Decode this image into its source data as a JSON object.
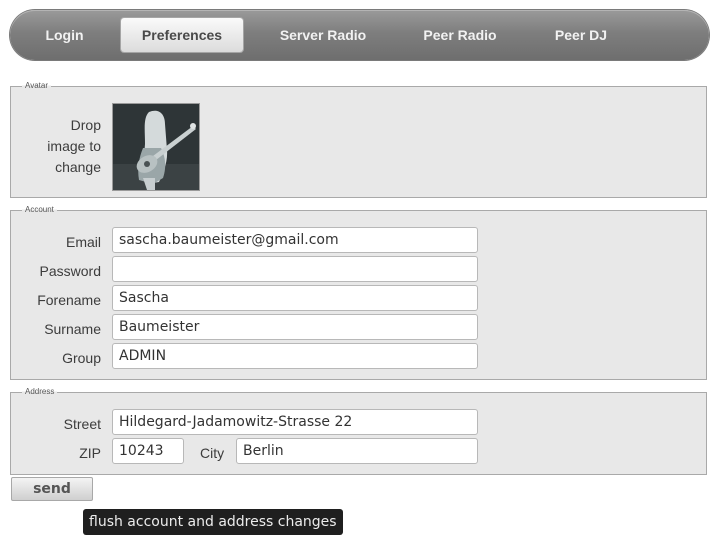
{
  "nav": {
    "tabs": [
      {
        "label": "Login"
      },
      {
        "label": "Preferences",
        "active": true
      },
      {
        "label": "Server Radio"
      },
      {
        "label": "Peer Radio"
      },
      {
        "label": "Peer DJ"
      }
    ]
  },
  "avatar": {
    "legend": "Avatar",
    "hint": "Drop image to change"
  },
  "account": {
    "legend": "Account",
    "email_label": "Email",
    "email_value": "sascha.baumeister@gmail.com",
    "password_label": "Password",
    "password_value": "",
    "forename_label": "Forename",
    "forename_value": "Sascha",
    "surname_label": "Surname",
    "surname_value": "Baumeister",
    "group_label": "Group",
    "group_value": "ADMIN"
  },
  "address": {
    "legend": "Address",
    "street_label": "Street",
    "street_value": "Hildegard-Jadamowitz-Strasse 22",
    "zip_label": "ZIP",
    "zip_value": "10243",
    "city_label": "City",
    "city_value": "Berlin"
  },
  "actions": {
    "send_label": "send",
    "tooltip": "flush account and address changes"
  }
}
